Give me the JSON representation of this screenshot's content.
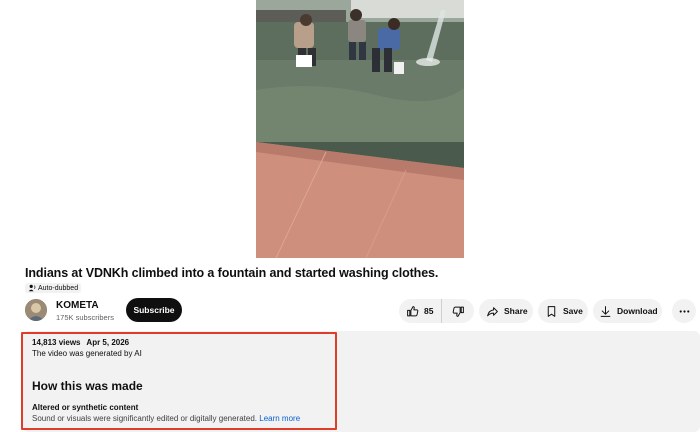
{
  "video": {
    "title": "Indians at VDNKh climbed into a fountain and started washing clothes.",
    "badge": "Auto-dubbed"
  },
  "channel": {
    "name": "KOMETA",
    "subscribers": "175K subscribers",
    "subscribe_label": "Subscribe"
  },
  "actions": {
    "like_count": "85",
    "share_label": "Share",
    "save_label": "Save",
    "download_label": "Download"
  },
  "description": {
    "views": "14,813 views",
    "date": "Apr 5, 2026",
    "ai_note": "The video was generated by AI",
    "section_title": "How this was made",
    "content_title": "Altered or synthetic content",
    "content_text": "Sound or visuals were significantly edited or digitally generated.",
    "learn_more": "Learn more"
  },
  "colors": {
    "highlight_border": "#e03c2a",
    "link": "#065fd4",
    "subscribe_bg": "#0f0f0f"
  }
}
